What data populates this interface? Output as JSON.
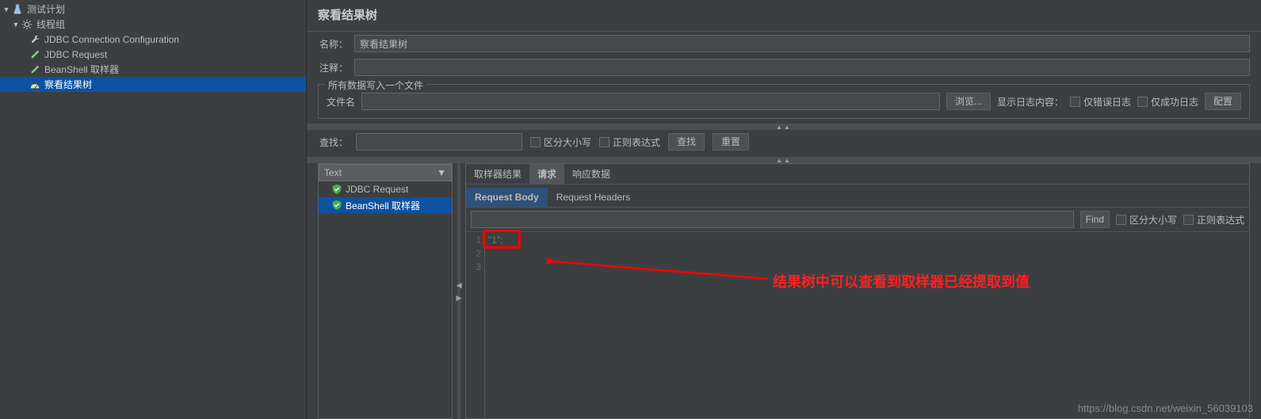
{
  "tree": {
    "root": "测试计划",
    "thread_group": "线程组",
    "items": [
      "JDBC Connection Configuration",
      "JDBC Request",
      "BeanShell 取样器",
      "察看结果树"
    ]
  },
  "panel": {
    "title": "察看结果树",
    "name_label": "名称：",
    "name_value": "察看结果树",
    "comment_label": "注释：",
    "comment_value": ""
  },
  "filebox": {
    "legend": "所有数据写入一个文件",
    "filename_label": "文件名",
    "filename_value": "",
    "browse": "浏览...",
    "log_label": "显示日志内容：",
    "only_errors": "仅错误日志",
    "only_success": "仅成功日志",
    "config": "配置"
  },
  "search": {
    "label": "查找：",
    "value": "",
    "case": "区分大小写",
    "regex": "正则表达式",
    "find_btn": "查找",
    "reset_btn": "重置"
  },
  "results": {
    "selector": "Text",
    "items": [
      {
        "label": "JDBC Request",
        "selected": false
      },
      {
        "label": "BeanShell 取样器",
        "selected": true
      }
    ]
  },
  "detail": {
    "tabs1": [
      "取样器结果",
      "请求",
      "响应数据"
    ],
    "tabs1_active": 1,
    "tabs2": [
      "Request Body",
      "Request Headers"
    ],
    "tabs2_active": 0,
    "find_btn": "Find",
    "find_case": "区分大小写",
    "find_regex": "正则表达式",
    "code_lines": [
      "\"1\";",
      "",
      ""
    ],
    "gutter": [
      "1",
      "2",
      "3"
    ]
  },
  "annotation": "结果树中可以查看到取样器已经提取到值",
  "watermark": "https://blog.csdn.net/weixin_56039103"
}
